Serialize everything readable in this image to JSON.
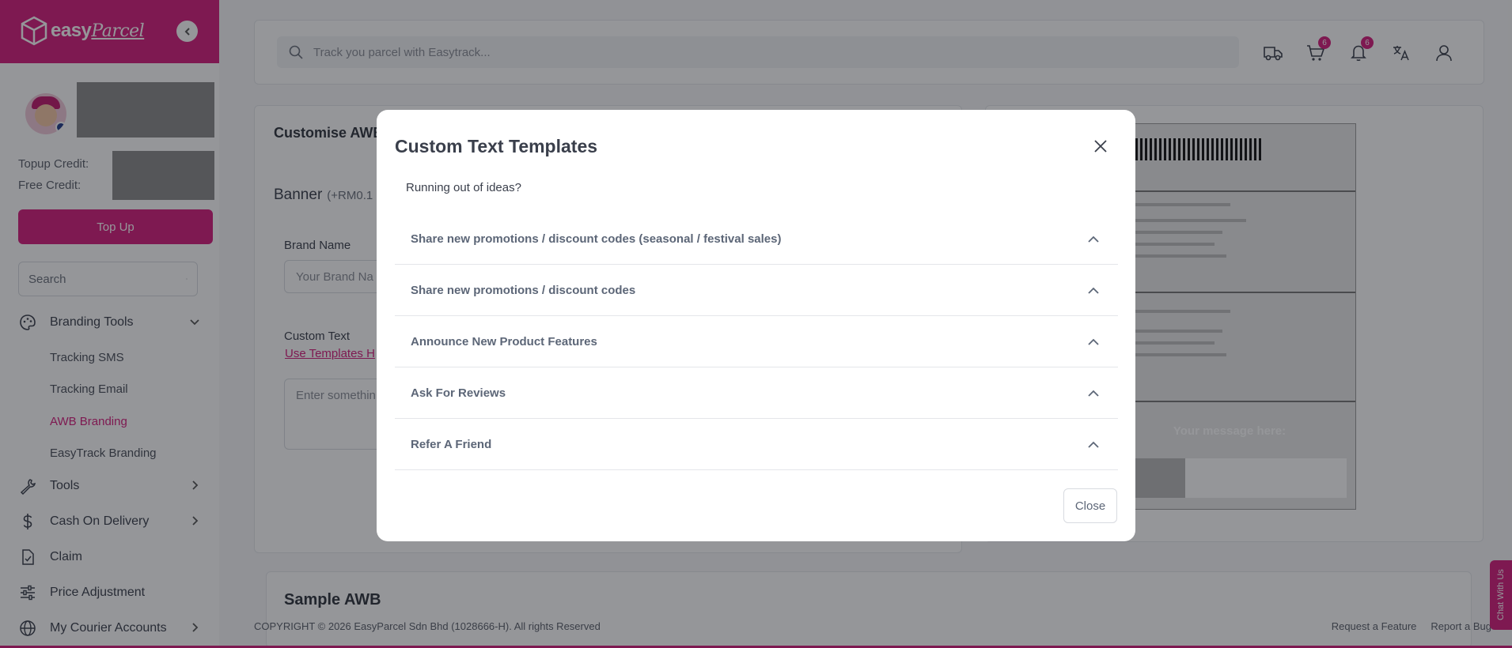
{
  "brand": {
    "logo_text": "easy",
    "logo_script": "Parcel",
    "accent": "#d61c7c"
  },
  "sidebar": {
    "topup_credit_label": "Topup Credit:",
    "free_credit_label": "Free Credit:",
    "topup_button": "Top Up",
    "search_placeholder": "Search",
    "items": [
      {
        "label": "Branding Tools",
        "icon": "palette-icon",
        "chevron": "down"
      },
      {
        "label": "Tools",
        "icon": "wrench-icon",
        "chevron": "right"
      },
      {
        "label": "Cash On Delivery",
        "icon": "dollar-icon",
        "chevron": "right"
      },
      {
        "label": "Claim",
        "icon": "document-icon"
      },
      {
        "label": "Price Adjustment",
        "icon": "sliders-icon"
      },
      {
        "label": "My Courier Accounts",
        "icon": "globe-icon",
        "chevron": "right"
      }
    ],
    "subitems": [
      {
        "label": "Tracking SMS"
      },
      {
        "label": "Tracking Email"
      },
      {
        "label": "AWB Branding",
        "active": true
      },
      {
        "label": "EasyTrack Branding"
      }
    ]
  },
  "topbar": {
    "search_placeholder": "Track you parcel with Easytrack...",
    "cart_count": "6",
    "notification_count": "6",
    "icons": [
      "truck-icon",
      "cart-icon",
      "bell-icon",
      "translate-icon",
      "user-icon"
    ]
  },
  "main": {
    "card_title": "Customise AWB",
    "banner_label": "Banner",
    "banner_price": "(+RM0.1",
    "brand_name_label": "Brand Name",
    "brand_name_placeholder": "Your Brand Na",
    "custom_text_label": "Custom Text",
    "use_templates_link": "Use Templates H",
    "custom_text_placeholder": "Enter somethin",
    "awb_message": "Your message here:",
    "sample_title": "Sample AWB"
  },
  "footer": {
    "copyright": "COPYRIGHT © 2026 EasyParcel Sdn Bhd (1028666-H). All rights Reserved",
    "links": [
      "Request a Feature",
      "Report a Bug"
    ],
    "chat": "Chat With Us"
  },
  "modal": {
    "title": "Custom Text Templates",
    "subtitle": "Running out of ideas?",
    "items": [
      {
        "label": "Share new promotions / discount codes (seasonal / festival sales)"
      },
      {
        "label": "Share new promotions / discount codes"
      },
      {
        "label": "Announce New Product Features"
      },
      {
        "label": "Ask For Reviews"
      },
      {
        "label": "Refer A Friend"
      }
    ],
    "close_button": "Close"
  }
}
